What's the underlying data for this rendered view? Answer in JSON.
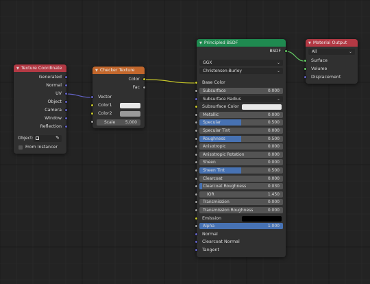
{
  "colors": {
    "coord_header": "#b33944",
    "checker_header": "#c2672c",
    "bsdf_header": "#1f8a50",
    "output_header": "#b33944",
    "sock_vector": "#6363c7",
    "sock_color": "#c7c729",
    "sock_float": "#a1a1a1",
    "sock_shader": "#63c763",
    "field_fill": "#4772b3"
  },
  "tex_coord": {
    "title": "Texture Coordinate",
    "outputs": [
      "Generated",
      "Normal",
      "UV",
      "Object",
      "Camera",
      "Window",
      "Reflection"
    ],
    "object_label": "Object:",
    "from_instancer": "From Instancer"
  },
  "checker": {
    "title": "Checker Texture",
    "out_color": "Color",
    "out_fac": "Fac",
    "in_vector": "Vector",
    "in_color1": "Color1",
    "in_color2": "Color2",
    "scale_label": "Scale",
    "scale_value": "5.000",
    "color1": "#e8e8e8",
    "color2": "#9a9a9a"
  },
  "bsdf": {
    "title": "Principled BSDF",
    "out_bsdf": "BSDF",
    "distribution": "GGX",
    "subsurface_method": "Christensen-Burley",
    "base_color": "Base Color",
    "subsurface_radius": "Subsurface Radius",
    "subsurface_color": "Subsurface Color",
    "subsurface_color_swatch": "#e8e8e8",
    "emission": "Emission",
    "emission_swatch": "#000000",
    "fields": [
      {
        "label": "Subsurface",
        "value": "0.000",
        "fill": 0
      },
      {
        "label": "Metallic",
        "value": "0.000",
        "fill": 0
      },
      {
        "label": "Specular",
        "value": "0.500",
        "fill": 0.5
      },
      {
        "label": "Specular Tint",
        "value": "0.000",
        "fill": 0
      },
      {
        "label": "Roughness",
        "value": "0.500",
        "fill": 0.5
      },
      {
        "label": "Anisotropic",
        "value": "0.000",
        "fill": 0
      },
      {
        "label": "Anisotropic Rotation",
        "value": "0.000",
        "fill": 0
      },
      {
        "label": "Sheen",
        "value": "0.000",
        "fill": 0
      },
      {
        "label": "Sheen Tint",
        "value": "0.500",
        "fill": 0.5
      },
      {
        "label": "Clearcoat",
        "value": "0.000",
        "fill": 0
      },
      {
        "label": "Clearcoat Roughness",
        "value": "0.030",
        "fill": 0.03
      },
      {
        "label": "IOR",
        "value": "1.450",
        "fill": 0
      },
      {
        "label": "Transmission",
        "value": "0.000",
        "fill": 0
      },
      {
        "label": "Transmission Roughness",
        "value": "0.000",
        "fill": 0
      }
    ],
    "alpha": {
      "label": "Alpha",
      "value": "1.000",
      "fill": 1
    },
    "normal": "Normal",
    "clearcoat_normal": "Clearcoat Normal",
    "tangent": "Tangent"
  },
  "output": {
    "title": "Material Output",
    "target": "All",
    "surface": "Surface",
    "volume": "Volume",
    "displacement": "Displacement"
  }
}
